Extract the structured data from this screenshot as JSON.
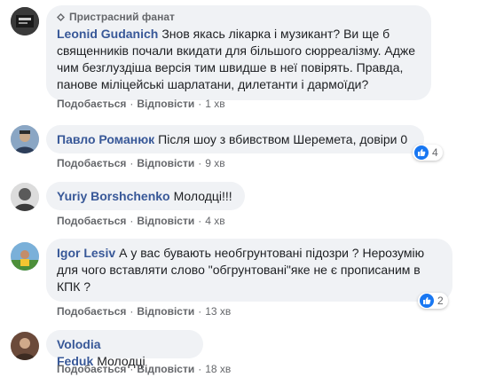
{
  "actions": {
    "like": "Подобається",
    "reply": "Відповісти",
    "separator": "·"
  },
  "comments": [
    {
      "badge": "Пристрасний фанат",
      "author": "Leonid Gudanich",
      "text": "Знов якась лікарка і музикант? Ви ще б священників почали вкидати для більшого сюрреалізму. Адже чим безглуздіша версія тим швидше в неї повірять. Правда, панове міліцейські шарлатани, дилетанти і дармоїди?",
      "time": "1 хв"
    },
    {
      "author": "Павло Романюк",
      "text": "Після шоу з вбивством Шеремета, довіри 0",
      "time": "9 хв",
      "reactions": "4"
    },
    {
      "author": "Yuriy Borshchenko",
      "text": "Молодці!!!",
      "time": "4 хв"
    },
    {
      "author": "Igor Lesiv",
      "text": "А у вас бувають необгрунтовані підозри ? Нерозумію для чого вставляти слово \"обгрунтовані\"яке не є прописаним в КПК ?",
      "time": "13 хв",
      "reactions": "2"
    },
    {
      "author": "Volodia Feduk",
      "text": "Молодці",
      "time": "18 хв"
    }
  ],
  "colors": {
    "author": "#385898",
    "bubble": "#f0f2f5",
    "meta": "#65676b",
    "like": "#1877f2"
  },
  "icons": [
    "fan-badge-icon",
    "like-icon"
  ]
}
